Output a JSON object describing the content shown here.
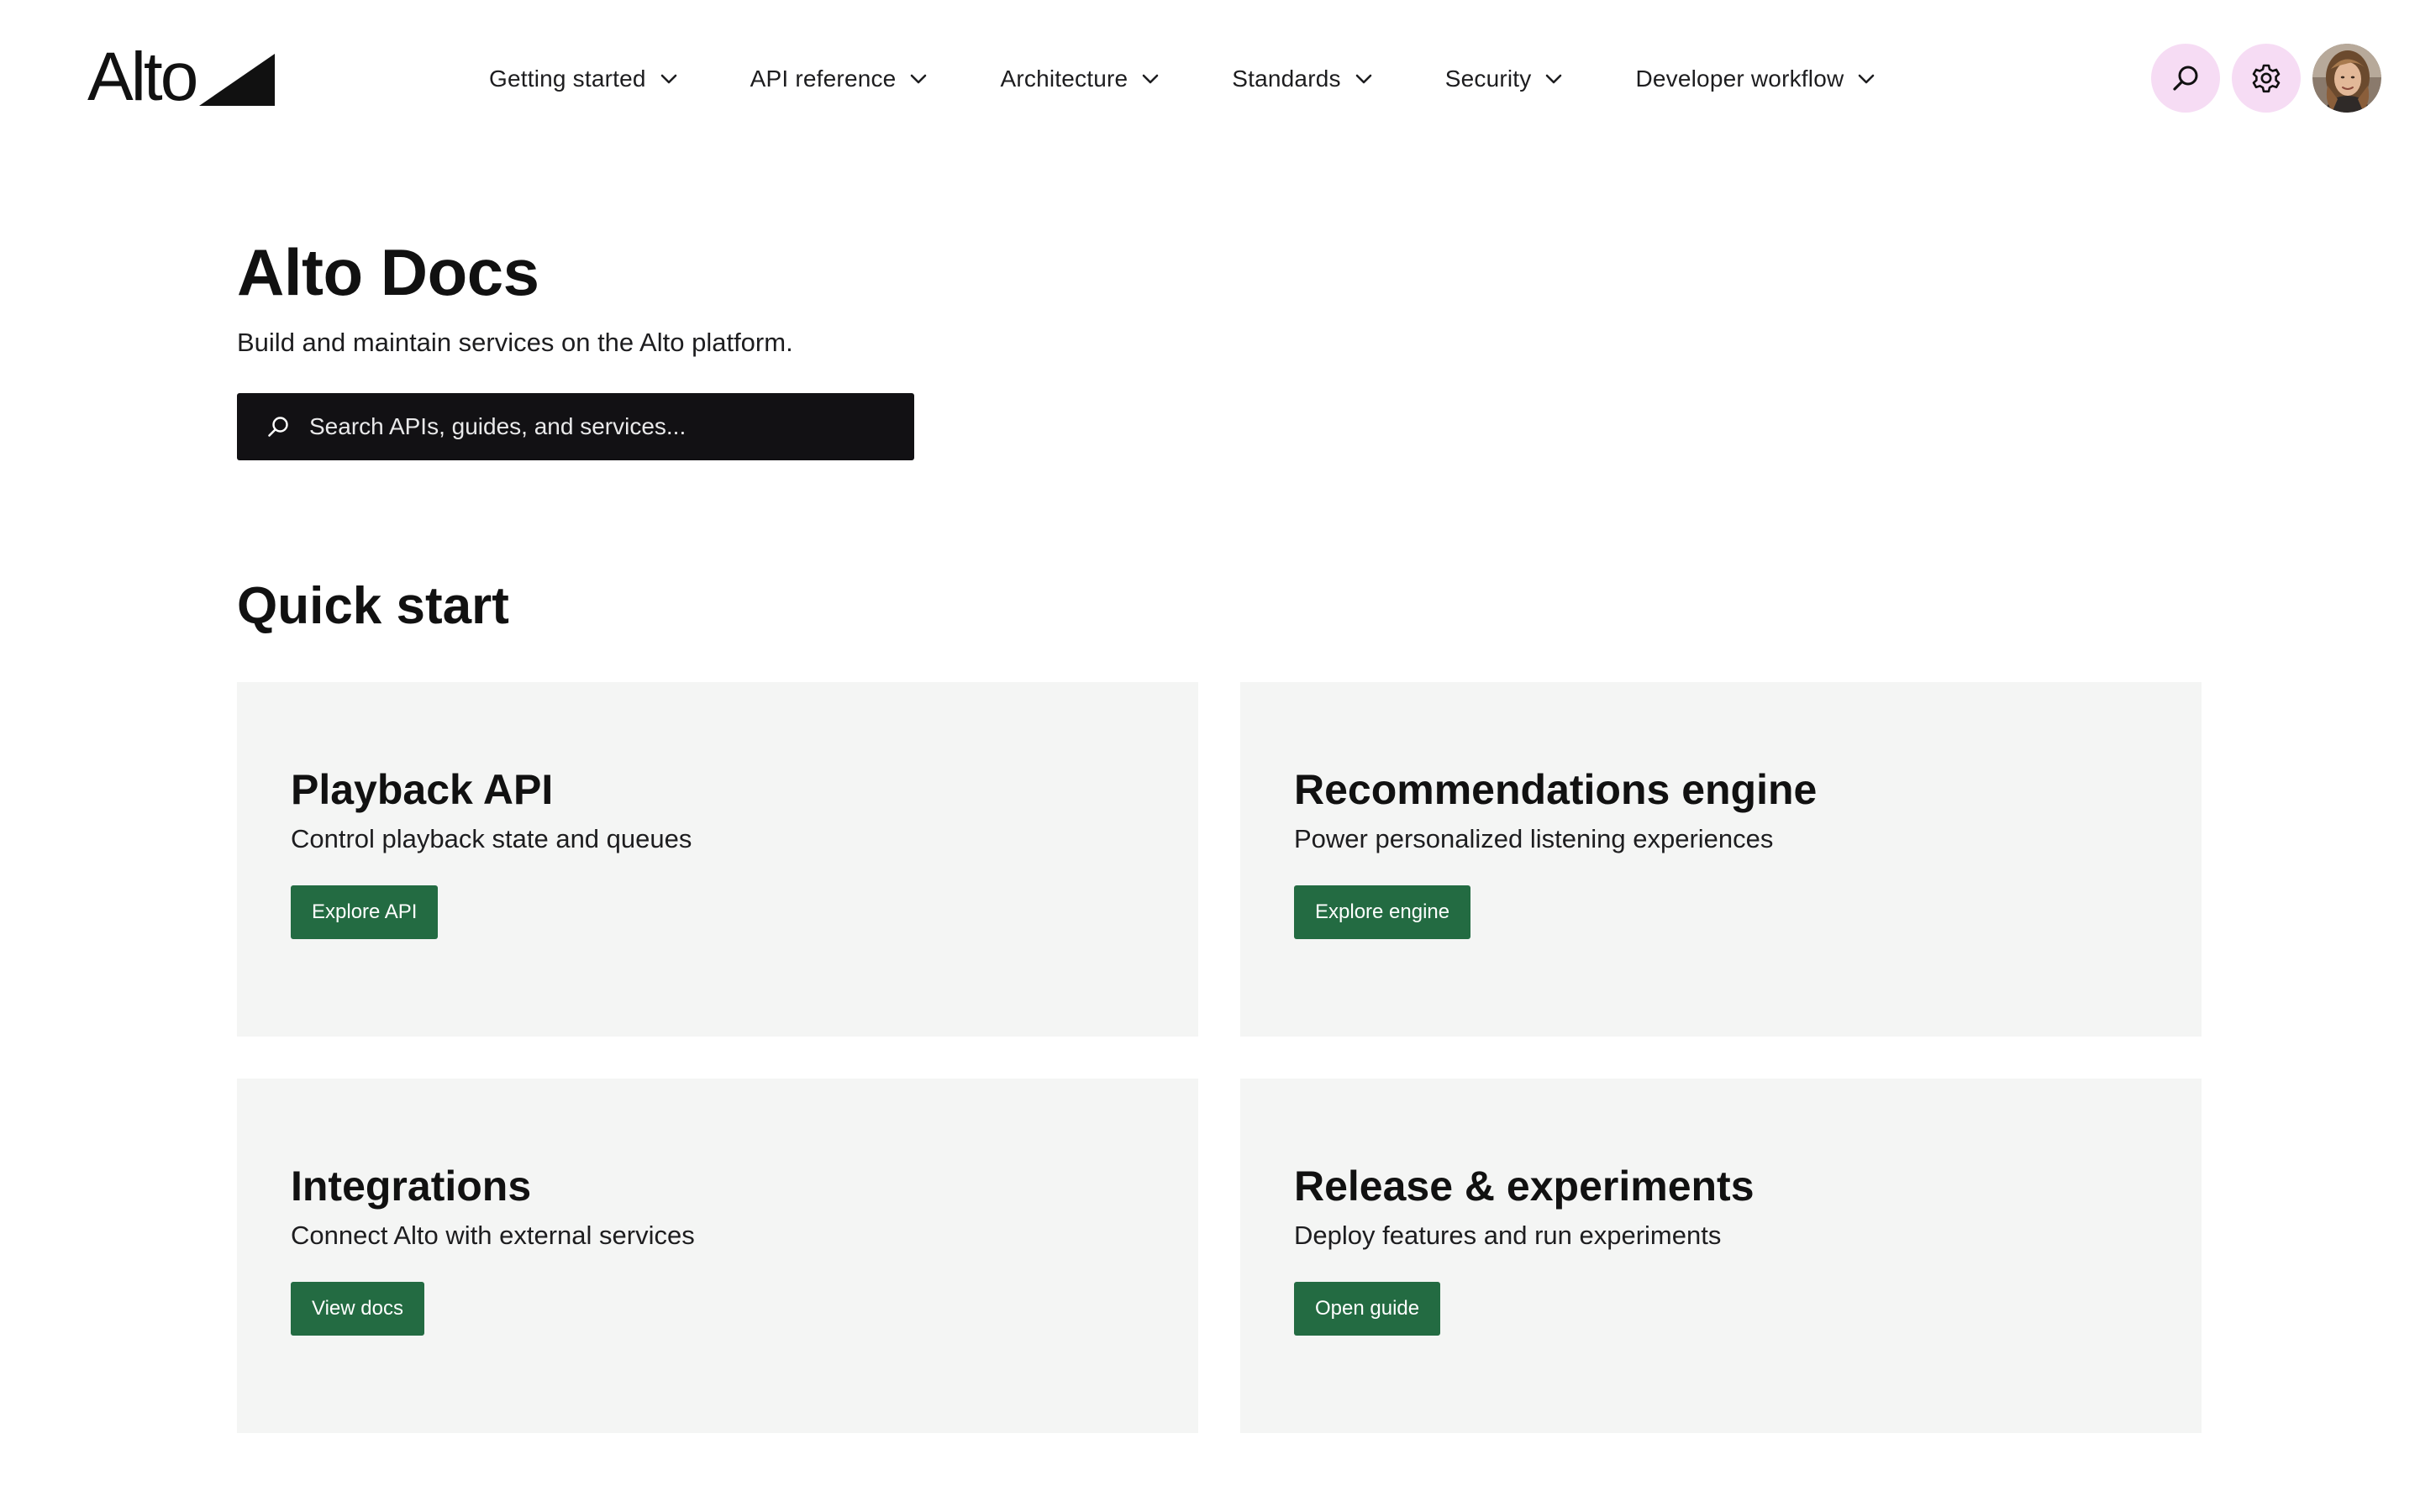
{
  "brand": {
    "name": "Alto",
    "accent": "#236b42",
    "icon_bg": "#f6dcf4",
    "search_bg": "#121114",
    "card_bg": "#f4f5f4"
  },
  "nav": {
    "items": [
      {
        "label": "Getting started",
        "icon": "chevron-down-icon"
      },
      {
        "label": "API reference",
        "icon": "chevron-down-icon"
      },
      {
        "label": "Architecture",
        "icon": "chevron-down-icon"
      },
      {
        "label": "Standards",
        "icon": "chevron-down-icon"
      },
      {
        "label": "Security",
        "icon": "chevron-down-icon"
      },
      {
        "label": "Developer workflow",
        "icon": "chevron-down-icon"
      }
    ]
  },
  "header_actions": {
    "search_icon": "search-icon",
    "settings_icon": "gear-icon",
    "avatar": "user-avatar"
  },
  "hero": {
    "title": "Alto Docs",
    "subtitle": "Build and maintain services on the Alto platform.",
    "search": {
      "placeholder": "Search APIs, guides, and services...",
      "value": ""
    }
  },
  "quick_start": {
    "title": "Quick start",
    "cards": [
      {
        "title": "Playback API",
        "description": "Control playback state and queues",
        "button": "Explore API"
      },
      {
        "title": "Recommendations engine",
        "description": "Power personalized listening experiences",
        "button": "Explore engine"
      },
      {
        "title": "Integrations",
        "description": "Connect Alto with external services",
        "button": "View docs"
      },
      {
        "title": "Release & experiments",
        "description": "Deploy features and run experiments",
        "button": "Open guide"
      }
    ]
  }
}
